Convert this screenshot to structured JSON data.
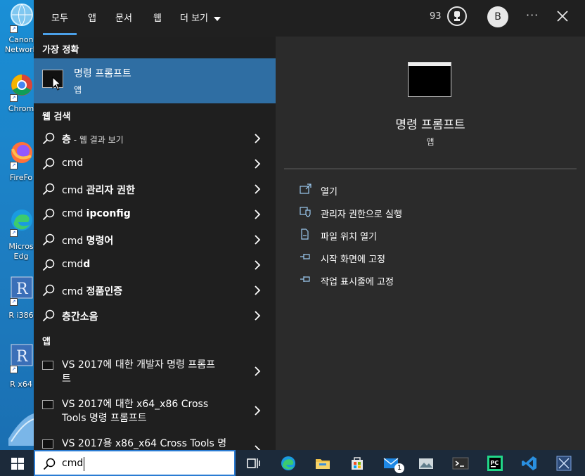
{
  "desktop": {
    "icons": [
      {
        "label": "Canon",
        "label2": "Network"
      },
      {
        "label": "Chrom",
        "label2": ""
      },
      {
        "label": "FireFo",
        "label2": ""
      },
      {
        "label": "Micros",
        "label2": "Edg"
      },
      {
        "label": "R i386",
        "label2": ""
      },
      {
        "label": "R x64",
        "label2": ""
      }
    ]
  },
  "tabs": [
    "모두",
    "앱",
    "문서",
    "웹",
    "더 보기"
  ],
  "header": {
    "badge_count": "93",
    "avatar_letter": "B",
    "more": "···"
  },
  "sections": {
    "best": "가장 정확",
    "web": "웹 검색",
    "apps": "앱"
  },
  "best_match": {
    "title": "명령 프롬프트",
    "subtitle": "앱"
  },
  "web_results": [
    {
      "prefix": "",
      "bold": "층",
      "hint": " - 웹 결과 보기"
    },
    {
      "prefix": "cmd",
      "bold": "",
      "hint": ""
    },
    {
      "prefix": "cmd ",
      "bold": "관리자 권한",
      "hint": ""
    },
    {
      "prefix": "cmd ",
      "bold": "ipconfig",
      "hint": ""
    },
    {
      "prefix": "cmd ",
      "bold": "명령어",
      "hint": ""
    },
    {
      "prefix": "cmd",
      "bold": "d",
      "hint": ""
    },
    {
      "prefix": "cmd ",
      "bold": "정품인증",
      "hint": ""
    },
    {
      "prefix": "",
      "bold": "층간소음",
      "hint": ""
    }
  ],
  "app_results": [
    {
      "line1": "VS 2017에 대한 개발자 명령 프롬프",
      "line2": "트"
    },
    {
      "line1": "VS 2017에 대한 x64_x86 Cross",
      "line2": "Tools 명령 프롬프트"
    },
    {
      "line1": "VS 2017용 x86_x64 Cross Tools 명",
      "line2": ""
    }
  ],
  "preview": {
    "title": "명령 프롬프트",
    "subtitle": "앱",
    "actions": [
      "열기",
      "관리자 권한으로 실행",
      "파일 위치 열기",
      "시작 화면에 고정",
      "작업 표시줄에 고정"
    ]
  },
  "taskbar": {
    "search_value": "cmd",
    "mail_badge": "1"
  },
  "colors": {
    "accent": "#4ba0e8",
    "selected_row": "#2f6ea3",
    "panel": "#2b2b2b",
    "list_bg": "#1f1f1f"
  }
}
